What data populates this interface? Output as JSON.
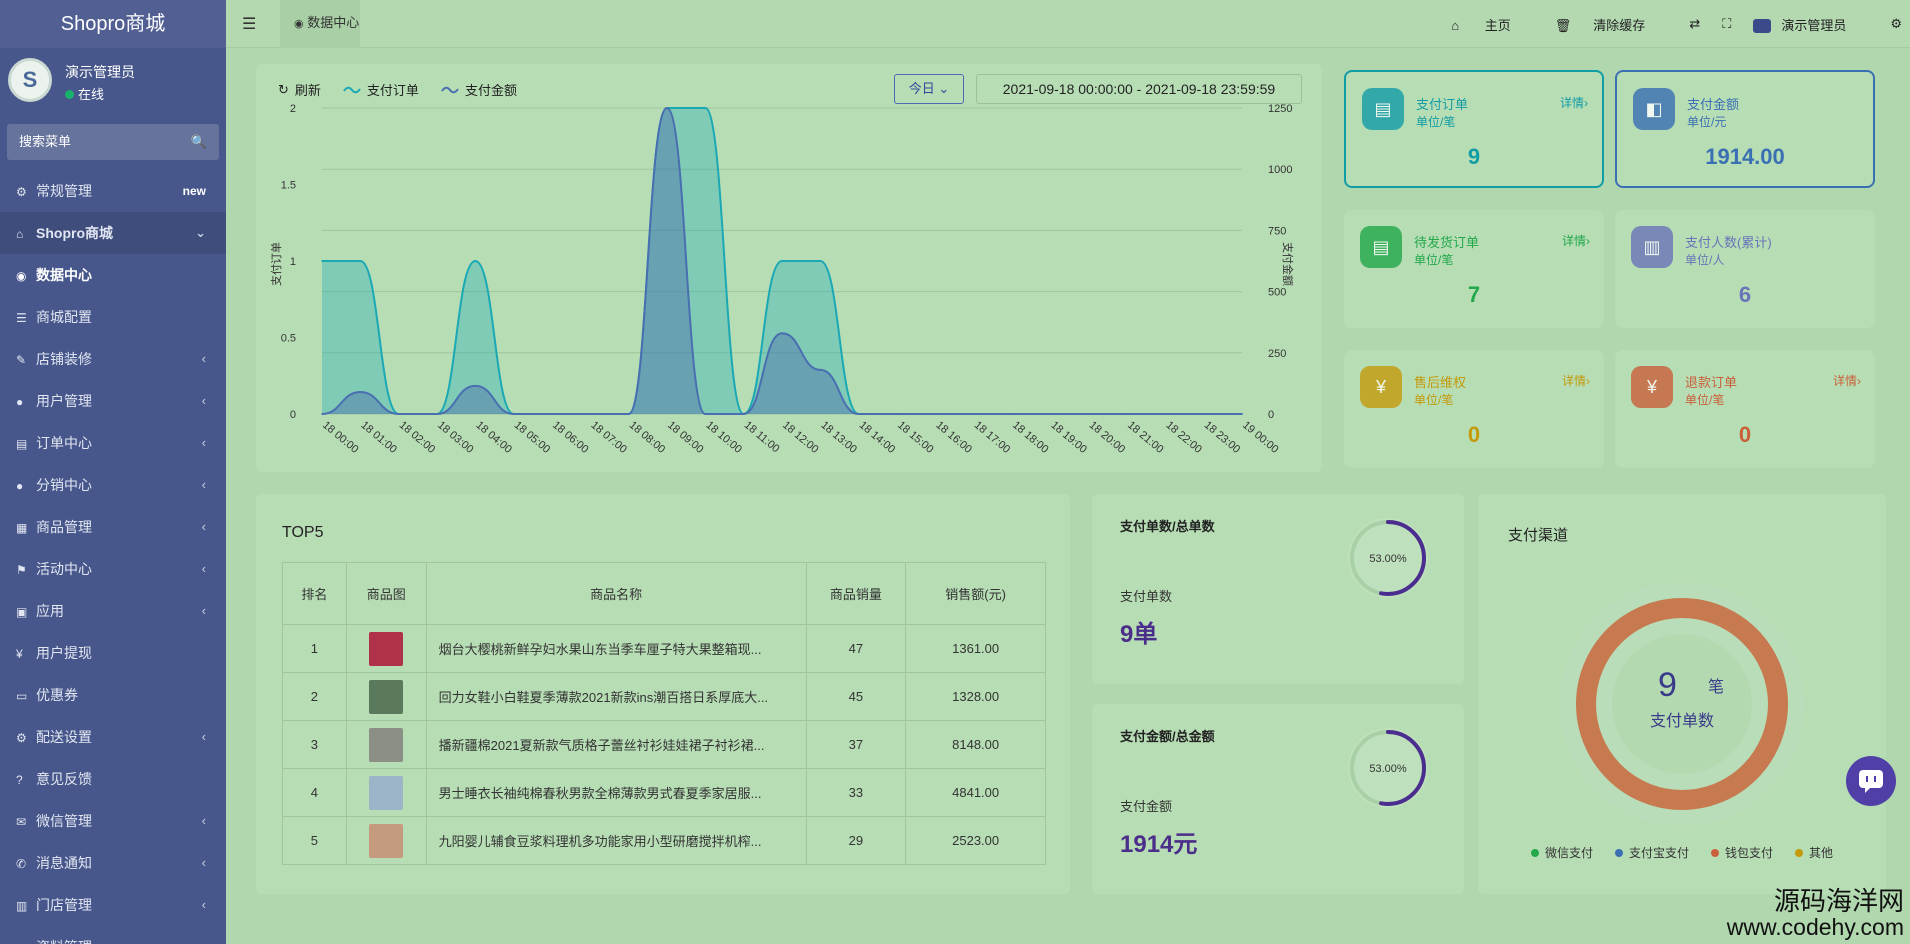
{
  "sidebar": {
    "brand": "Shopro商城",
    "user": {
      "name": "演示管理员",
      "status": "在线"
    },
    "search_placeholder": "搜索菜单",
    "items": [
      {
        "label": "常规管理",
        "icon": "cogs-icon",
        "badge": "new"
      },
      {
        "label": "Shopro商城",
        "icon": "home-icon",
        "expanded": true
      },
      {
        "label": "数据中心",
        "icon": "dashboard-icon",
        "active": true
      },
      {
        "label": "商城配置",
        "icon": "sliders-icon"
      },
      {
        "label": "店铺装修",
        "icon": "brush-icon",
        "arrow": true
      },
      {
        "label": "用户管理",
        "icon": "user-icon",
        "arrow": true
      },
      {
        "label": "订单中心",
        "icon": "file-icon",
        "arrow": true
      },
      {
        "label": "分销中心",
        "icon": "users-icon",
        "arrow": true
      },
      {
        "label": "商品管理",
        "icon": "list-icon",
        "arrow": true
      },
      {
        "label": "活动中心",
        "icon": "flag-icon",
        "arrow": true
      },
      {
        "label": "应用",
        "icon": "briefcase-icon",
        "arrow": true
      },
      {
        "label": "用户提现",
        "icon": "yen-icon"
      },
      {
        "label": "优惠券",
        "icon": "ticket-icon"
      },
      {
        "label": "配送设置",
        "icon": "cogs-icon",
        "arrow": true
      },
      {
        "label": "意见反馈",
        "icon": "question-icon"
      },
      {
        "label": "微信管理",
        "icon": "wechat-icon",
        "arrow": true
      },
      {
        "label": "消息通知",
        "icon": "bullhorn-icon",
        "arrow": true
      },
      {
        "label": "门店管理",
        "icon": "bank-icon",
        "arrow": true
      },
      {
        "label": "资料管理",
        "icon": "folder-icon",
        "arrow": true
      }
    ]
  },
  "topbar": {
    "tab": "数据中心",
    "home": "主页",
    "clear_cache": "清除缓存",
    "admin": "演示管理员"
  },
  "chart_panel": {
    "refresh": "刷新",
    "today": "今日",
    "date_range": "2021-09-18 00:00:00  -  2021-09-18 23:59:59"
  },
  "chart_data": {
    "type": "area",
    "x": [
      "18 00:00",
      "18 01:00",
      "18 02:00",
      "18 03:00",
      "18 04:00",
      "18 05:00",
      "18 06:00",
      "18 07:00",
      "18 08:00",
      "18 09:00",
      "18 10:00",
      "18 11:00",
      "18 12:00",
      "18 13:00",
      "18 14:00",
      "18 15:00",
      "18 16:00",
      "18 17:00",
      "18 18:00",
      "18 19:00",
      "18 20:00",
      "18 21:00",
      "18 22:00",
      "18 23:00",
      "19 00:00"
    ],
    "series": [
      {
        "name": "支付订单",
        "axis": "left",
        "color": "#1aa8b5",
        "values": [
          1,
          1,
          0,
          0,
          1,
          0,
          0,
          0,
          0,
          2,
          2,
          0,
          1,
          1,
          0,
          0,
          0,
          0,
          0,
          0,
          0,
          0,
          0,
          0,
          0
        ]
      },
      {
        "name": "支付金额",
        "axis": "right",
        "color": "#4a6fb0",
        "values": [
          0,
          90,
          0,
          0,
          115,
          0,
          0,
          0,
          0,
          1250,
          0,
          0,
          330,
          180,
          0,
          0,
          0,
          0,
          0,
          0,
          0,
          0,
          0,
          0,
          0
        ]
      }
    ],
    "ylabel_left": "支付订单",
    "ylabel_right": "支付金额",
    "yticks_left": [
      "2",
      "1.5",
      "1",
      "0.5",
      "0"
    ],
    "yticks_right": [
      "1250",
      "1000",
      "750",
      "500",
      "250",
      "0"
    ],
    "ylim_left": [
      0,
      2
    ],
    "ylim_right": [
      0,
      1250
    ],
    "grid": true
  },
  "stats": [
    {
      "title": "支付订单",
      "unit": "单位/笔",
      "value": "9",
      "detail": "详情",
      "color": "#129ca6",
      "selected": true
    },
    {
      "title": "支付金额",
      "unit": "单位/元",
      "value": "1914.00",
      "detail": "",
      "color": "#3a6fb3",
      "selected": true
    },
    {
      "title": "待发货订单",
      "unit": "单位/笔",
      "value": "7",
      "detail": "详情",
      "color": "#22a84a"
    },
    {
      "title": "支付人数(累计)",
      "unit": "单位/人",
      "value": "6",
      "detail": "",
      "color": "#6a74b8"
    },
    {
      "title": "售后维权",
      "unit": "单位/笔",
      "value": "0",
      "detail": "详情",
      "color": "#c49a0a"
    },
    {
      "title": "退款订单",
      "unit": "单位/笔",
      "value": "0",
      "detail": "详情",
      "color": "#c9603a"
    }
  ],
  "top5": {
    "title": "TOP5",
    "headers": [
      "排名",
      "商品图",
      "商品名称",
      "商品销量",
      "销售额(元)"
    ],
    "rows": [
      {
        "rank": "1",
        "name": "烟台大樱桃新鲜孕妇水果山东当季车厘子特大果整箱现...",
        "sales": "47",
        "amount": "1361.00",
        "thumb": "#b0324a"
      },
      {
        "rank": "2",
        "name": "回力女鞋小白鞋夏季薄款2021新款ins潮百搭日系厚底大...",
        "sales": "45",
        "amount": "1328.00",
        "thumb": "#5b7a5d"
      },
      {
        "rank": "3",
        "name": "播新疆棉2021夏新款气质格子蕾丝衬衫娃娃裙子衬衫裙...",
        "sales": "37",
        "amount": "8148.00",
        "thumb": "#8b8f86"
      },
      {
        "rank": "4",
        "name": "男士睡衣长袖纯棉春秋男款全棉薄款男式春夏季家居服...",
        "sales": "33",
        "amount": "4841.00",
        "thumb": "#9cb4c8"
      },
      {
        "rank": "5",
        "name": "九阳婴儿辅食豆浆料理机多功能家用小型研磨搅拌机榨...",
        "sales": "29",
        "amount": "2523.00",
        "thumb": "#c59a7e"
      }
    ]
  },
  "ratios": [
    {
      "title": "支付单数/总单数",
      "label": "支付单数",
      "value": "9单",
      "percent_text": "53.00%",
      "percent": 53
    },
    {
      "title": "支付金额/总金额",
      "label": "支付金额",
      "value": "1914元",
      "percent_text": "53.00%",
      "percent": 53
    }
  ],
  "channel": {
    "title": "支付渠道",
    "center_value": "9",
    "center_unit": "笔",
    "center_label": "支付单数",
    "legend": [
      {
        "name": "微信支付",
        "color": "#22a84a"
      },
      {
        "name": "支付宝支付",
        "color": "#3a6fb3"
      },
      {
        "name": "钱包支付",
        "color": "#c9603a"
      },
      {
        "name": "其他",
        "color": "#c49a0a"
      }
    ]
  },
  "watermark": {
    "line1": "源码海洋网",
    "line2": "www.codehy.com"
  }
}
